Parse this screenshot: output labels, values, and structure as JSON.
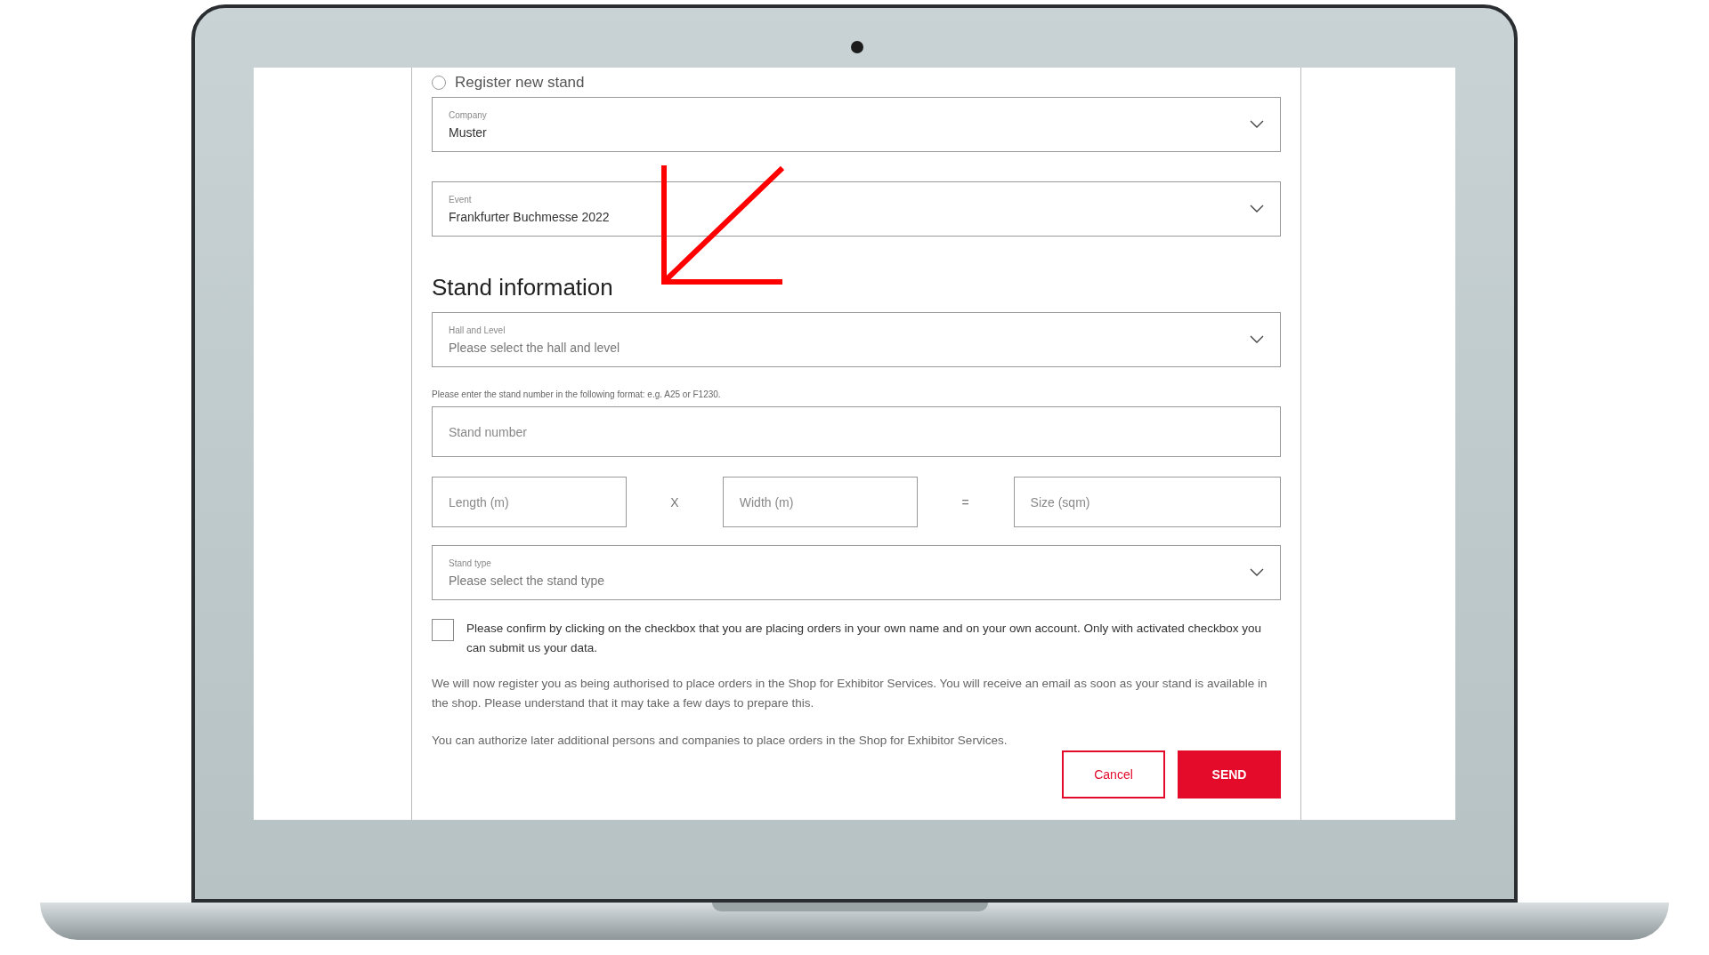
{
  "radio_option": {
    "label": "Register new stand",
    "selected": false
  },
  "company_select": {
    "label": "Company",
    "value": "Muster"
  },
  "event_select": {
    "label": "Event",
    "value": "Frankfurter Buchmesse 2022"
  },
  "section_heading": "Stand information",
  "hall_select": {
    "label": "Hall and Level",
    "placeholder": "Please select the hall and level"
  },
  "stand_number_hint": "Please enter the stand number in the following format: e.g. A25 or F1230.",
  "stand_number_field": {
    "placeholder": "Stand number"
  },
  "dimensions": {
    "length": {
      "placeholder": "Length (m)"
    },
    "times_sign": "X",
    "width": {
      "placeholder": "Width (m)"
    },
    "equals_sign": "=",
    "size": {
      "placeholder": "Size (sqm)"
    }
  },
  "stand_type_select": {
    "label": "Stand type",
    "placeholder": "Please select the stand type"
  },
  "confirmation": {
    "checked": false,
    "text": "Please confirm by clicking on the checkbox that you are placing orders in your own name and on your own account. Only with activated checkbox you can submit us your data."
  },
  "notes": [
    "We will now register you as being authorised to place orders in the Shop for Exhibitor Services. You will receive an email as soon as your stand is available in the shop. Please understand that it may take a few days to prepare this.",
    "You can authorize later additional persons and companies to place orders in the Shop for Exhibitor Services."
  ],
  "buttons": [
    {
      "label": "Cancel",
      "kind": "secondary"
    },
    {
      "label": "SEND",
      "kind": "primary"
    }
  ]
}
